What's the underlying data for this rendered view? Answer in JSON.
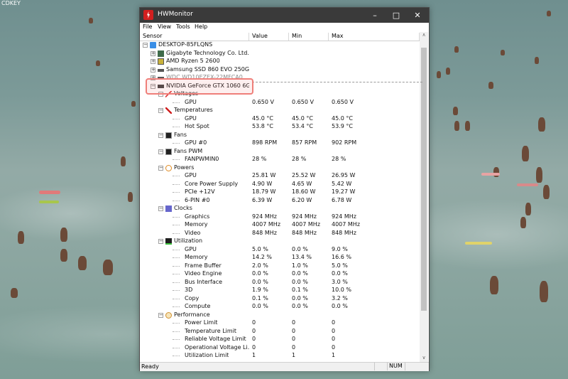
{
  "background": {
    "corner_text": "CDKEY"
  },
  "window": {
    "title": "HWMonitor",
    "menu": [
      "File",
      "View",
      "Tools",
      "Help"
    ],
    "columns": [
      "Sensor",
      "Value",
      "Min",
      "Max"
    ],
    "status_ready": "Ready",
    "status_num": "NUM"
  },
  "rows": [
    {
      "lvl": 0,
      "exp": "−",
      "icon": "computer-icon",
      "name": "DESKTOP-85FLQNS"
    },
    {
      "lvl": 1,
      "exp": "+",
      "icon": "motherboard-icon",
      "name": "Gigabyte Technology Co. Ltd. ..."
    },
    {
      "lvl": 1,
      "exp": "+",
      "icon": "cpu-icon",
      "name": "AMD Ryzen 5 2600"
    },
    {
      "lvl": 1,
      "exp": "+",
      "icon": "drive-icon",
      "name": "Samsung SSD 860 EVO 250GB"
    },
    {
      "lvl": 1,
      "exp": "+",
      "icon": "drive-icon",
      "name": "WDC WD10EZEX-22MFCA0"
    },
    {
      "lvl": 1,
      "exp": "−",
      "icon": "gpu-icon",
      "name": "NVIDIA GeForce GTX 1060 6GB"
    },
    {
      "lvl": 2,
      "exp": "−",
      "icon": "voltage-icon",
      "name": "Voltages"
    },
    {
      "lvl": 3,
      "name": "GPU",
      "value": "0.650 V",
      "min": "0.650 V",
      "max": "0.650 V"
    },
    {
      "lvl": 2,
      "exp": "−",
      "icon": "thermometer-icon",
      "name": "Temperatures"
    },
    {
      "lvl": 3,
      "name": "GPU",
      "value": "45.0 °C",
      "min": "45.0 °C",
      "max": "45.0 °C"
    },
    {
      "lvl": 3,
      "name": "Hot Spot",
      "value": "53.8 °C",
      "min": "53.4 °C",
      "max": "53.9 °C"
    },
    {
      "lvl": 2,
      "exp": "−",
      "icon": "fan-icon",
      "name": "Fans"
    },
    {
      "lvl": 3,
      "name": "GPU #0",
      "value": "898 RPM",
      "min": "857 RPM",
      "max": "902 RPM"
    },
    {
      "lvl": 2,
      "exp": "−",
      "icon": "fan-icon",
      "name": "Fans PWM"
    },
    {
      "lvl": 3,
      "name": "FANPWMIN0",
      "value": "28 %",
      "min": "28 %",
      "max": "28 %"
    },
    {
      "lvl": 2,
      "exp": "−",
      "icon": "power-icon",
      "name": "Powers"
    },
    {
      "lvl": 3,
      "name": "GPU",
      "value": "25.81 W",
      "min": "25.52 W",
      "max": "26.95 W"
    },
    {
      "lvl": 3,
      "name": "Core Power Supply",
      "value": "4.90 W",
      "min": "4.65 W",
      "max": "5.42 W"
    },
    {
      "lvl": 3,
      "name": "PCIe +12V",
      "value": "18.79 W",
      "min": "18.60 W",
      "max": "19.27 W"
    },
    {
      "lvl": 3,
      "name": "6-PIN #0",
      "value": "6.39 W",
      "min": "6.20 W",
      "max": "6.78 W"
    },
    {
      "lvl": 2,
      "exp": "−",
      "icon": "clock-icon",
      "name": "Clocks"
    },
    {
      "lvl": 3,
      "name": "Graphics",
      "value": "924 MHz",
      "min": "924 MHz",
      "max": "924 MHz"
    },
    {
      "lvl": 3,
      "name": "Memory",
      "value": "4007 MHz",
      "min": "4007 MHz",
      "max": "4007 MHz"
    },
    {
      "lvl": 3,
      "name": "Video",
      "value": "848 MHz",
      "min": "848 MHz",
      "max": "848 MHz"
    },
    {
      "lvl": 2,
      "exp": "−",
      "icon": "utilization-icon",
      "name": "Utilization"
    },
    {
      "lvl": 3,
      "name": "GPU",
      "value": "5.0 %",
      "min": "0.0 %",
      "max": "9.0 %"
    },
    {
      "lvl": 3,
      "name": "Memory",
      "value": "14.2 %",
      "min": "13.4 %",
      "max": "16.6 %"
    },
    {
      "lvl": 3,
      "name": "Frame Buffer",
      "value": "2.0 %",
      "min": "1.0 %",
      "max": "5.0 %"
    },
    {
      "lvl": 3,
      "name": "Video Engine",
      "value": "0.0 %",
      "min": "0.0 %",
      "max": "0.0 %"
    },
    {
      "lvl": 3,
      "name": "Bus Interface",
      "value": "0.0 %",
      "min": "0.0 %",
      "max": "3.0 %"
    },
    {
      "lvl": 3,
      "name": "3D",
      "value": "1.9 %",
      "min": "0.1 %",
      "max": "10.0 %"
    },
    {
      "lvl": 3,
      "name": "Copy",
      "value": "0.1 %",
      "min": "0.0 %",
      "max": "3.2 %"
    },
    {
      "lvl": 3,
      "name": "Compute",
      "value": "0.0 %",
      "min": "0.0 %",
      "max": "0.0 %"
    },
    {
      "lvl": 2,
      "exp": "−",
      "icon": "performance-icon",
      "name": "Performance"
    },
    {
      "lvl": 3,
      "name": "Power Limit",
      "value": "0",
      "min": "0",
      "max": "0"
    },
    {
      "lvl": 3,
      "name": "Temperature Limit",
      "value": "0",
      "min": "0",
      "max": "0"
    },
    {
      "lvl": 3,
      "name": "Reliable Voltage Limit",
      "value": "0",
      "min": "0",
      "max": "0"
    },
    {
      "lvl": 3,
      "name": "Operational Voltage Li...",
      "value": "0",
      "min": "0",
      "max": "0"
    },
    {
      "lvl": 3,
      "name": "Utilization Limit",
      "value": "1",
      "min": "1",
      "max": "1"
    }
  ]
}
